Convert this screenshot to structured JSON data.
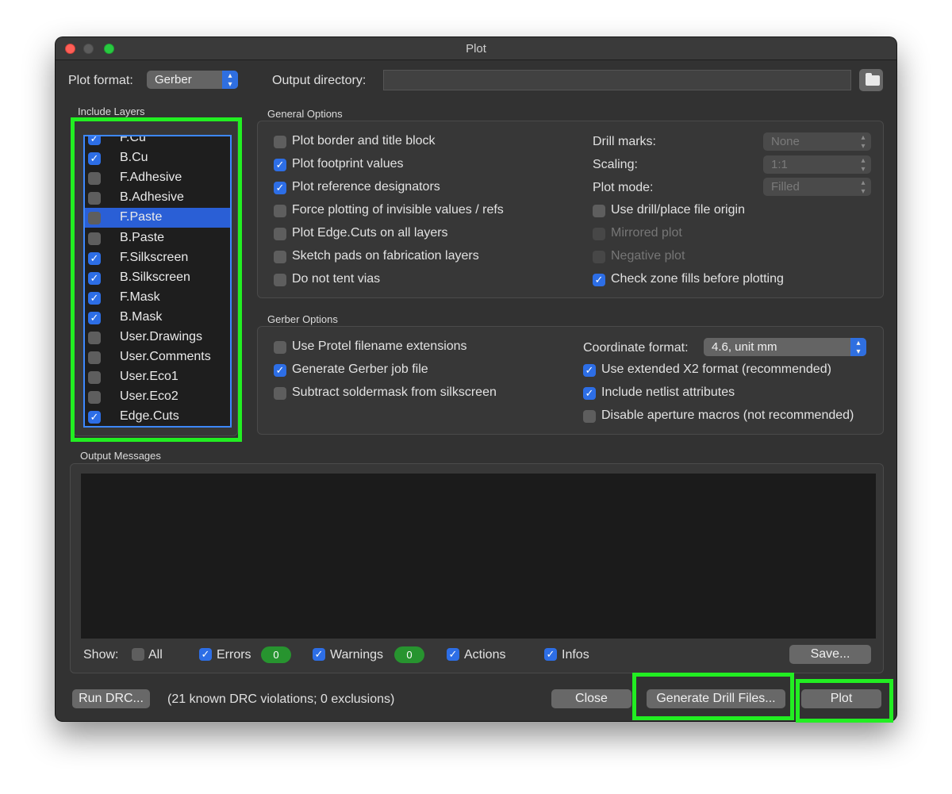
{
  "window": {
    "title": "Plot"
  },
  "plot_format": {
    "label": "Plot format:",
    "value": "Gerber"
  },
  "output_directory": {
    "label": "Output directory:",
    "value": ""
  },
  "include_layers": {
    "title": "Include Layers",
    "items": [
      {
        "name": "F.Cu",
        "checked": true,
        "selected": false
      },
      {
        "name": "B.Cu",
        "checked": true,
        "selected": false
      },
      {
        "name": "F.Adhesive",
        "checked": false,
        "selected": false
      },
      {
        "name": "B.Adhesive",
        "checked": false,
        "selected": false
      },
      {
        "name": "F.Paste",
        "checked": false,
        "selected": true
      },
      {
        "name": "B.Paste",
        "checked": false,
        "selected": false
      },
      {
        "name": "F.Silkscreen",
        "checked": true,
        "selected": false
      },
      {
        "name": "B.Silkscreen",
        "checked": true,
        "selected": false
      },
      {
        "name": "F.Mask",
        "checked": true,
        "selected": false
      },
      {
        "name": "B.Mask",
        "checked": true,
        "selected": false
      },
      {
        "name": "User.Drawings",
        "checked": false,
        "selected": false
      },
      {
        "name": "User.Comments",
        "checked": false,
        "selected": false
      },
      {
        "name": "User.Eco1",
        "checked": false,
        "selected": false
      },
      {
        "name": "User.Eco2",
        "checked": false,
        "selected": false
      },
      {
        "name": "Edge.Cuts",
        "checked": true,
        "selected": false
      }
    ]
  },
  "general_options": {
    "title": "General Options",
    "left": [
      {
        "label": "Plot border and title block",
        "checked": false
      },
      {
        "label": "Plot footprint values",
        "checked": true
      },
      {
        "label": "Plot reference designators",
        "checked": true
      },
      {
        "label": "Force plotting of invisible values / refs",
        "checked": false
      },
      {
        "label": "Plot Edge.Cuts on all layers",
        "checked": false
      },
      {
        "label": "Sketch pads on fabrication layers",
        "checked": false
      },
      {
        "label": "Do not tent vias",
        "checked": false
      }
    ],
    "drill_marks": {
      "label": "Drill marks:",
      "value": "None"
    },
    "scaling": {
      "label": "Scaling:",
      "value": "1:1"
    },
    "plot_mode": {
      "label": "Plot mode:",
      "value": "Filled"
    },
    "right": [
      {
        "label": "Use drill/place file origin",
        "checked": false,
        "disabled": false
      },
      {
        "label": "Mirrored plot",
        "checked": false,
        "disabled": true
      },
      {
        "label": "Negative plot",
        "checked": false,
        "disabled": true
      },
      {
        "label": "Check zone fills before plotting",
        "checked": true,
        "disabled": false
      }
    ]
  },
  "gerber_options": {
    "title": "Gerber Options",
    "left": [
      {
        "label": "Use Protel filename extensions",
        "checked": false
      },
      {
        "label": "Generate Gerber job file",
        "checked": true
      },
      {
        "label": "Subtract soldermask from silkscreen",
        "checked": false
      }
    ],
    "coordinate_format": {
      "label": "Coordinate format:",
      "value": "4.6, unit mm"
    },
    "right": [
      {
        "label": "Use extended X2 format (recommended)",
        "checked": true
      },
      {
        "label": "Include netlist attributes",
        "checked": true
      },
      {
        "label": "Disable aperture macros (not recommended)",
        "checked": false
      }
    ]
  },
  "output_messages": {
    "title": "Output Messages",
    "show_label": "Show:",
    "filters": {
      "all": {
        "label": "All",
        "checked": false
      },
      "errors": {
        "label": "Errors",
        "checked": true,
        "count": "0"
      },
      "warnings": {
        "label": "Warnings",
        "checked": true,
        "count": "0"
      },
      "actions": {
        "label": "Actions",
        "checked": true
      },
      "infos": {
        "label": "Infos",
        "checked": true
      }
    },
    "save_label": "Save..."
  },
  "footer": {
    "run_drc": "Run DRC...",
    "drc_status": "(21 known DRC violations; 0 exclusions)",
    "close": "Close",
    "generate_drill": "Generate Drill Files...",
    "plot": "Plot"
  },
  "colors": {
    "accent": "#2d6ee6",
    "highlight": "#22ee22",
    "badge": "#27942f"
  }
}
